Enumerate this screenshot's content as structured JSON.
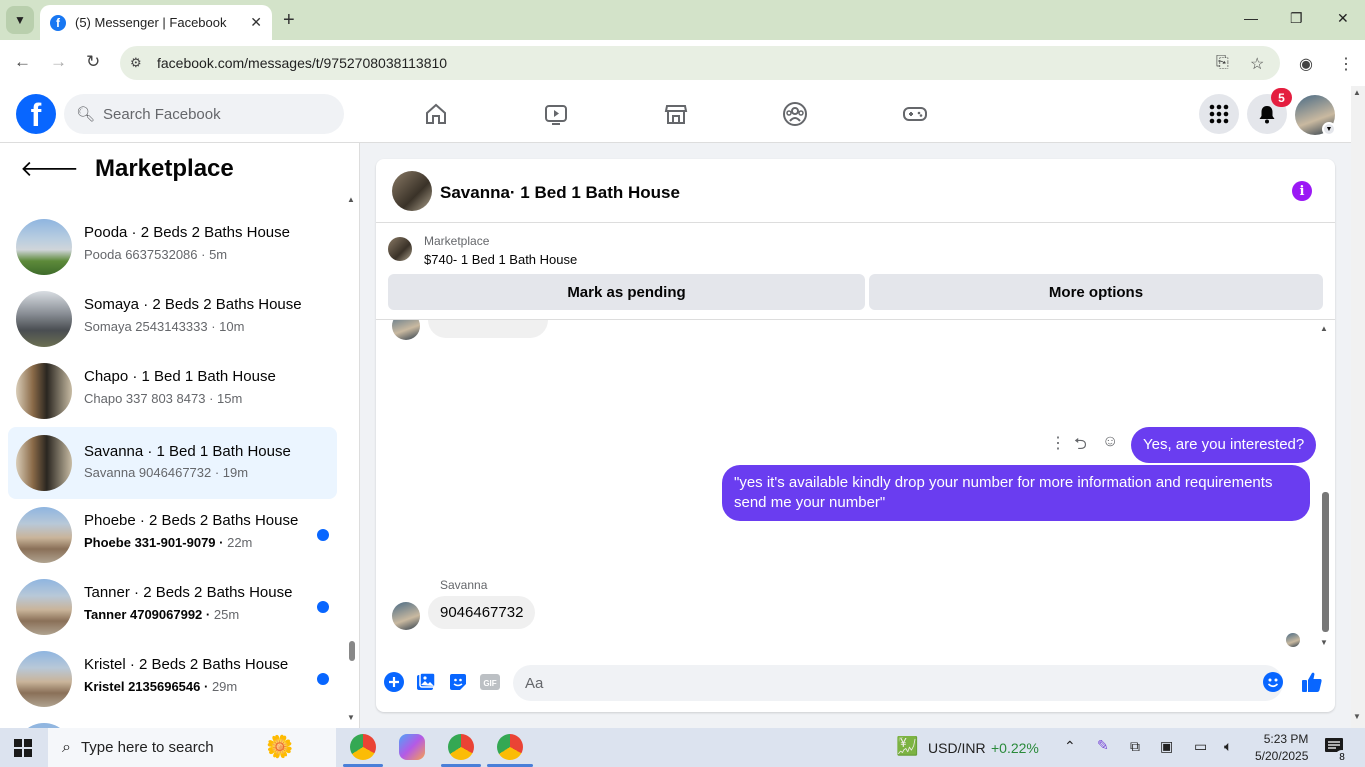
{
  "browser": {
    "tab_title": "(5) Messenger | Facebook",
    "url": "facebook.com/messages/t/9752708038113810"
  },
  "fb": {
    "search_placeholder": "Search Facebook",
    "notification_count": "5"
  },
  "sidebar": {
    "title": "Marketplace",
    "conversations": [
      {
        "name": "Pooda · 2 Beds 2 Baths House",
        "sub": "Pooda 6637532086",
        "time": "5m",
        "unread": false
      },
      {
        "name": "Somaya · 2 Beds 2 Baths House",
        "sub": "Somaya 2543143333",
        "time": "10m",
        "unread": false
      },
      {
        "name": "Chapo · 1 Bed 1 Bath House",
        "sub": "Chapo 337 803 8473",
        "time": "15m",
        "unread": false
      },
      {
        "name": "Savanna · 1 Bed 1 Bath House",
        "sub": "Savanna 9046467732",
        "time": "19m",
        "unread": false,
        "active": true
      },
      {
        "name": "Phoebe · 2 Beds 2 Baths House",
        "sub": "Phoebe 331-901-9079",
        "time": "22m",
        "unread": true
      },
      {
        "name": "Tanner · 2 Beds 2 Baths House",
        "sub": "Tanner 4709067992",
        "time": "25m",
        "unread": true
      },
      {
        "name": "Kristel · 2 Beds 2 Baths House",
        "sub": "Kristel 2135696546",
        "time": "29m",
        "unread": true
      }
    ]
  },
  "chat": {
    "title": "Savanna· 1 Bed 1 Bath House",
    "marketplace_label": "Marketplace",
    "listing": "$740- 1 Bed 1 Bath House",
    "mark_pending": "Mark as pending",
    "more_options": "More options",
    "messages": {
      "out1": "Yes, are you interested?",
      "out2": "\"yes it's available kindly drop your number for more information and requirements send me your number\"",
      "in_sender": "Savanna",
      "in1": "9046467732"
    },
    "composer_placeholder": "Aa"
  },
  "taskbar": {
    "search_placeholder": "Type here to search",
    "ticker": "USD/INR",
    "ticker_change": "+0.22%",
    "time": "5:23 PM",
    "date": "5/20/2025",
    "notif_count": "8"
  },
  "colors": {
    "accent_blue": "#0866ff",
    "bubble_purple": "#6a3df0",
    "info_purple": "#9b19f5",
    "badge_red": "#e41e3f"
  }
}
